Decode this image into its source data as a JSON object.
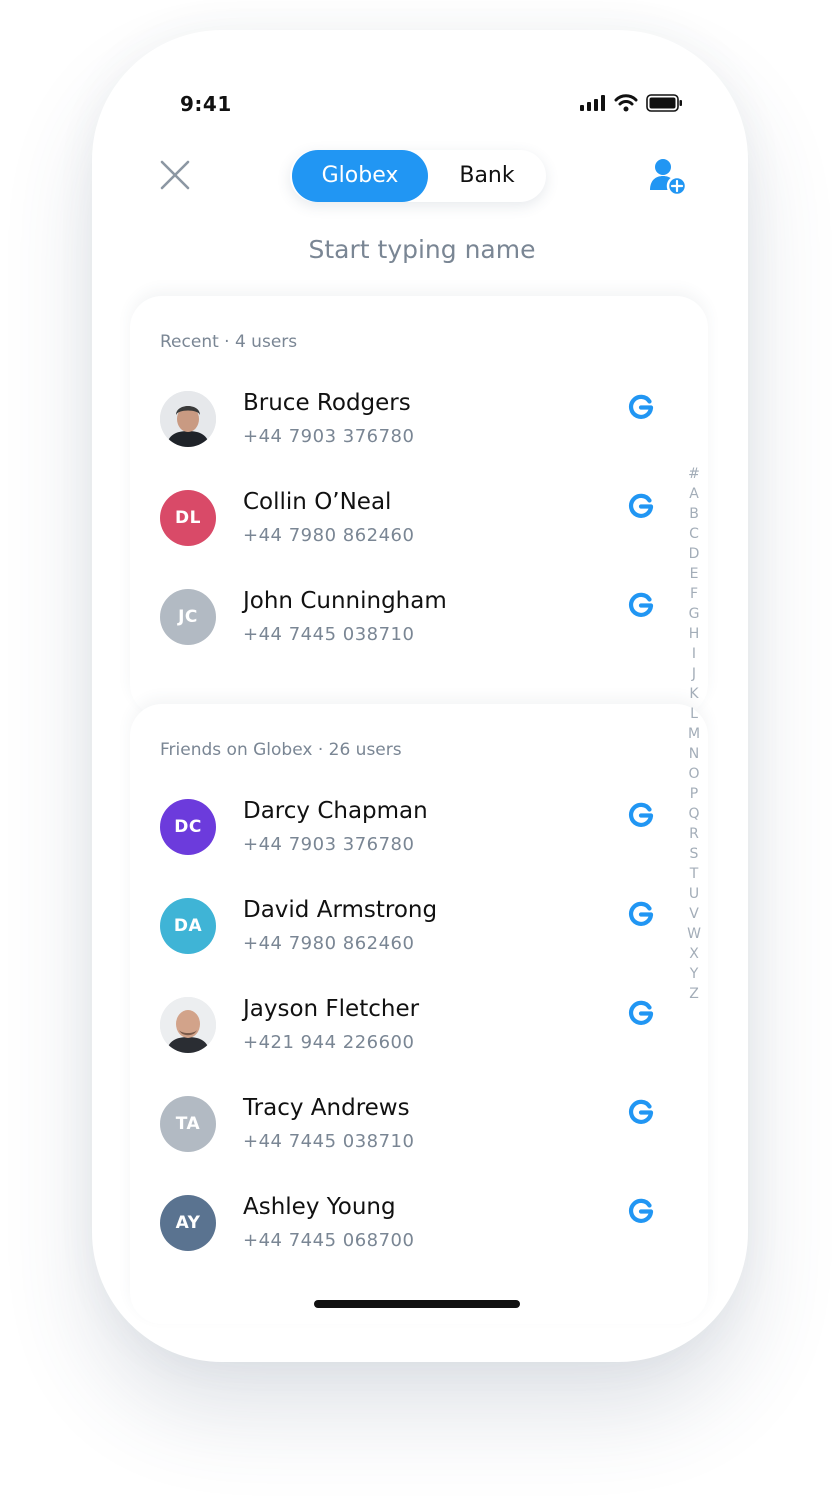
{
  "status_bar": {
    "time": "9:41"
  },
  "header": {
    "close_icon": "close-icon",
    "segments": [
      "Globex",
      "Bank"
    ],
    "active_segment": "Globex",
    "add_user_icon": "add-user-icon",
    "accent_color": "#2196f3"
  },
  "search": {
    "placeholder": "Start typing name",
    "value": ""
  },
  "recent": {
    "title": "Recent · 4 users",
    "contacts": [
      {
        "name": "Bruce Rodgers",
        "phone": "+44 7903 376780",
        "initials": "",
        "avatar_color": "#3b3f46",
        "photo": true
      },
      {
        "name": "Collin O’Neal",
        "phone": "+44 7980 862460",
        "initials": "DL",
        "avatar_color": "#d94a68"
      },
      {
        "name": "John Cunningham",
        "phone": "+44 7445 038710",
        "initials": "JC",
        "avatar_color": "#b2bac3"
      }
    ]
  },
  "friends": {
    "title": "Friends on Globex · 26 users",
    "contacts": [
      {
        "name": "Darcy Chapman",
        "phone": "+44 7903 376780",
        "initials": "DC",
        "avatar_color": "#6c3bdc"
      },
      {
        "name": "David Armstrong",
        "phone": "+44 7980 862460",
        "initials": "DA",
        "avatar_color": "#3fb4d6"
      },
      {
        "name": "Jayson Fletcher",
        "phone": "+421 944 226600",
        "initials": "",
        "avatar_color": "#8a6a5a",
        "photo": true
      },
      {
        "name": "Tracy Andrews",
        "phone": "+44 7445 038710",
        "initials": "TA",
        "avatar_color": "#b2bac3"
      },
      {
        "name": "Ashley Young",
        "phone": "+44 7445 068700",
        "initials": "AY",
        "avatar_color": "#5a7390"
      }
    ]
  },
  "alphabet_index": [
    "#",
    "A",
    "B",
    "C",
    "D",
    "E",
    "F",
    "G",
    "H",
    "I",
    "J",
    "K",
    "L",
    "M",
    "N",
    "O",
    "P",
    "Q",
    "R",
    "S",
    "T",
    "U",
    "V",
    "W",
    "X",
    "Y",
    "Z"
  ],
  "globex_icon": "globex-g-icon"
}
